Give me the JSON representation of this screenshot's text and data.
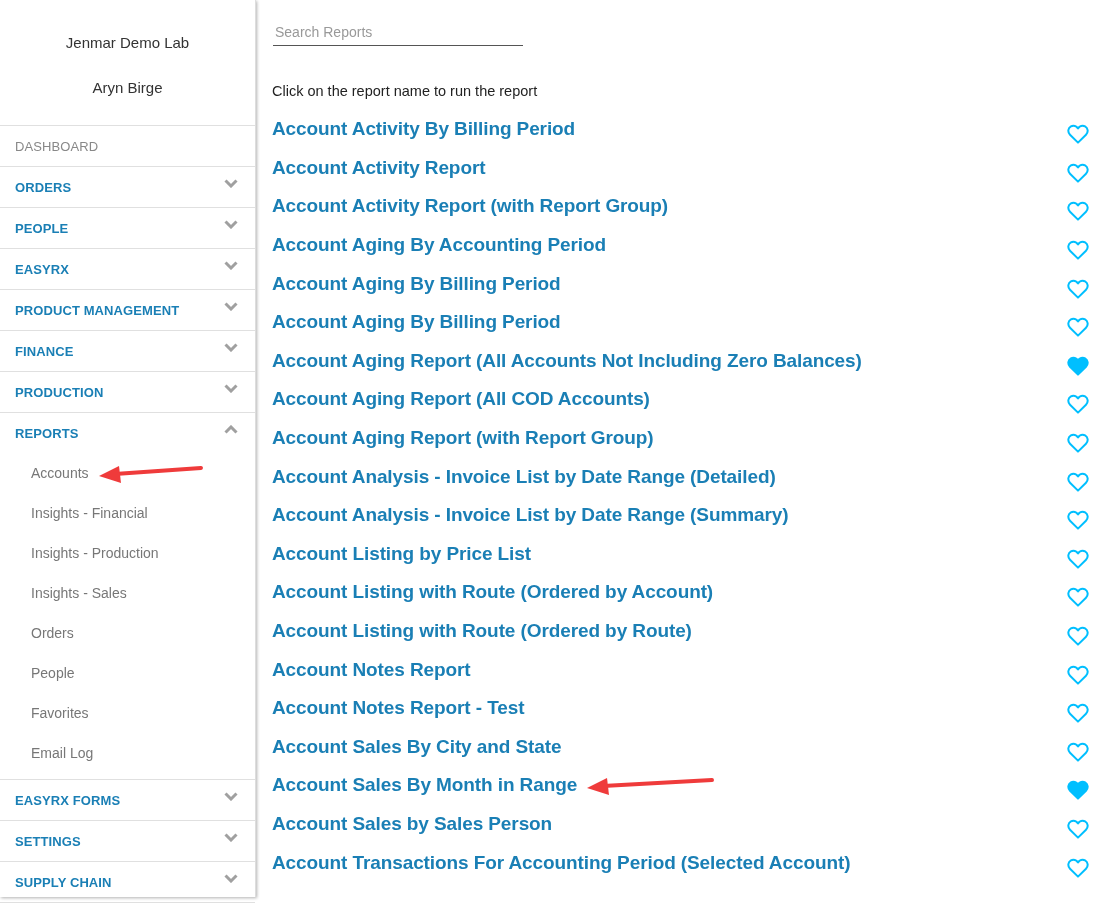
{
  "sidebar": {
    "org_name": "Jenmar Demo Lab",
    "user_name": "Aryn Birge",
    "items": [
      {
        "label": "DASHBOARD",
        "kind": "link"
      },
      {
        "label": "ORDERS",
        "kind": "group",
        "expanded": false
      },
      {
        "label": "PEOPLE",
        "kind": "group",
        "expanded": false
      },
      {
        "label": "EASYRX",
        "kind": "group",
        "expanded": false
      },
      {
        "label": "PRODUCT MANAGEMENT",
        "kind": "group",
        "expanded": false
      },
      {
        "label": "FINANCE",
        "kind": "group",
        "expanded": false
      },
      {
        "label": "PRODUCTION",
        "kind": "group",
        "expanded": false
      },
      {
        "label": "REPORTS",
        "kind": "group",
        "expanded": true,
        "children": [
          {
            "label": "Accounts",
            "annotated": true
          },
          {
            "label": "Insights - Financial",
            "annotated": false
          },
          {
            "label": "Insights - Production",
            "annotated": false
          },
          {
            "label": "Insights - Sales",
            "annotated": false
          },
          {
            "label": "Orders",
            "annotated": false
          },
          {
            "label": "People",
            "annotated": false
          },
          {
            "label": "Favorites",
            "annotated": false
          },
          {
            "label": "Email Log",
            "annotated": false
          }
        ]
      },
      {
        "label": "EASYRX FORMS",
        "kind": "group",
        "expanded": false
      },
      {
        "label": "SETTINGS",
        "kind": "group",
        "expanded": false
      },
      {
        "label": "SUPPLY CHAIN",
        "kind": "group",
        "expanded": false
      }
    ]
  },
  "search": {
    "placeholder": "Search Reports"
  },
  "instruction": "Click on the report name to run the report",
  "reports": [
    {
      "name": "Account Activity By Billing Period",
      "favorite": false,
      "annotated": false
    },
    {
      "name": "Account Activity Report",
      "favorite": false,
      "annotated": false
    },
    {
      "name": "Account Activity Report (with Report Group)",
      "favorite": false,
      "annotated": false
    },
    {
      "name": "Account Aging By Accounting Period",
      "favorite": false,
      "annotated": false
    },
    {
      "name": "Account Aging By Billing Period",
      "favorite": false,
      "annotated": false
    },
    {
      "name": "Account Aging By Billing Period",
      "favorite": false,
      "annotated": false
    },
    {
      "name": "Account Aging Report (All Accounts Not Including Zero Balances)",
      "favorite": true,
      "annotated": false
    },
    {
      "name": "Account Aging Report (All COD Accounts)",
      "favorite": false,
      "annotated": false
    },
    {
      "name": "Account Aging Report (with Report Group)",
      "favorite": false,
      "annotated": false
    },
    {
      "name": "Account Analysis - Invoice List by Date Range (Detailed)",
      "favorite": false,
      "annotated": false
    },
    {
      "name": "Account Analysis - Invoice List by Date Range (Summary)",
      "favorite": false,
      "annotated": false
    },
    {
      "name": "Account Listing by Price List",
      "favorite": false,
      "annotated": false
    },
    {
      "name": "Account Listing with Route (Ordered by Account)",
      "favorite": false,
      "annotated": false
    },
    {
      "name": "Account Listing with Route (Ordered by Route)",
      "favorite": false,
      "annotated": false
    },
    {
      "name": "Account Notes Report",
      "favorite": false,
      "annotated": false
    },
    {
      "name": "Account Notes Report - Test",
      "favorite": false,
      "annotated": false
    },
    {
      "name": "Account Sales By City and State",
      "favorite": false,
      "annotated": false
    },
    {
      "name": "Account Sales By Month in Range",
      "favorite": true,
      "annotated": true
    },
    {
      "name": "Account Sales by Sales Person",
      "favorite": false,
      "annotated": false
    },
    {
      "name": "Account Transactions For Accounting Period (Selected Account)",
      "favorite": false,
      "annotated": false
    }
  ]
}
